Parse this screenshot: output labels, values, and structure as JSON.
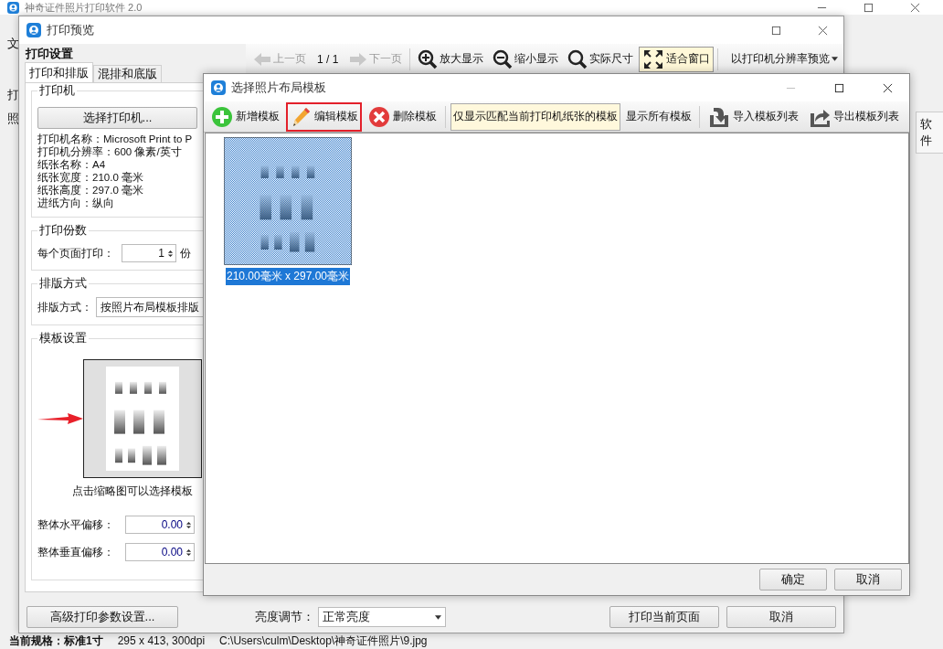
{
  "main_window": {
    "title": "神奇证件照片打印软件 2.0",
    "menu_fragments": [
      "文",
      "打",
      "照"
    ],
    "side_fragment": "软件",
    "status_bar": [
      "当前规格：标准1寸",
      "295 x 413, 300dpi",
      "C:\\Users\\culm\\Desktop\\神奇证件照片\\9.jpg"
    ]
  },
  "preview_window": {
    "title": "打印预览",
    "settings_title": "打印设置",
    "tabs": [
      {
        "label": "打印和排版",
        "selected": true
      },
      {
        "label": "混排和底版",
        "selected": false
      }
    ],
    "printer_group": {
      "title": "打印机",
      "button": "选择打印机...",
      "info": [
        "打印机名称：Microsoft Print to P",
        "打印机分辨率：600 像素/英寸",
        "纸张名称：A4",
        "纸张宽度：210.0 毫米",
        "纸张高度：297.0 毫米",
        "进纸方向：纵向"
      ]
    },
    "copies_group": {
      "title": "打印份数",
      "label": "每个页面打印：",
      "value": "1",
      "unit": "份"
    },
    "layout_group": {
      "title": "排版方式",
      "label": "排版方式：",
      "value": "按照片布局模板排版"
    },
    "template_group": {
      "title": "模板设置",
      "hint": "点击缩略图可以选择模板",
      "offsets": [
        {
          "label": "整体水平偏移：",
          "value": "0.00"
        },
        {
          "label": "整体垂直偏移：",
          "value": "0.00"
        }
      ]
    },
    "toolbar": [
      {
        "kind": "nav",
        "label": "上一页",
        "disabled": true
      },
      {
        "kind": "page",
        "label": "1 / 1"
      },
      {
        "kind": "nav",
        "label": "下一页",
        "disabled": true
      },
      {
        "kind": "tool",
        "label": "放大显示",
        "selected": false
      },
      {
        "kind": "tool",
        "label": "缩小显示",
        "selected": false
      },
      {
        "kind": "tool",
        "label": "实际尺寸",
        "selected": false
      },
      {
        "kind": "tool",
        "label": "适合窗口",
        "selected": true
      },
      {
        "kind": "dropdown",
        "label": "以打印机分辨率预览"
      }
    ],
    "advanced_button": "高级打印参数设置...",
    "brightness": {
      "label": "亮度调节：",
      "value": "正常亮度"
    },
    "print_button": "打印当前页面",
    "cancel_button": "取消"
  },
  "template_dialog": {
    "title": "选择照片布局模板",
    "toolbar": [
      {
        "kind": "button",
        "label": "新增模板",
        "highlighted": false
      },
      {
        "kind": "button",
        "label": "编辑模板",
        "highlighted": true
      },
      {
        "kind": "button",
        "label": "删除模板",
        "highlighted": false
      },
      {
        "kind": "toggle",
        "label": "仅显示匹配当前打印机纸张的模板",
        "selected": true
      },
      {
        "kind": "toggle",
        "label": "显示所有模板",
        "selected": false
      },
      {
        "kind": "button",
        "label": "导入模板列表",
        "highlighted": false
      },
      {
        "kind": "button",
        "label": "导出模板列表",
        "highlighted": false
      }
    ],
    "templates": [
      {
        "caption": "210.00毫米 x 297.00毫米",
        "selected": true
      }
    ],
    "buttons": [
      "确定",
      "取消"
    ]
  }
}
